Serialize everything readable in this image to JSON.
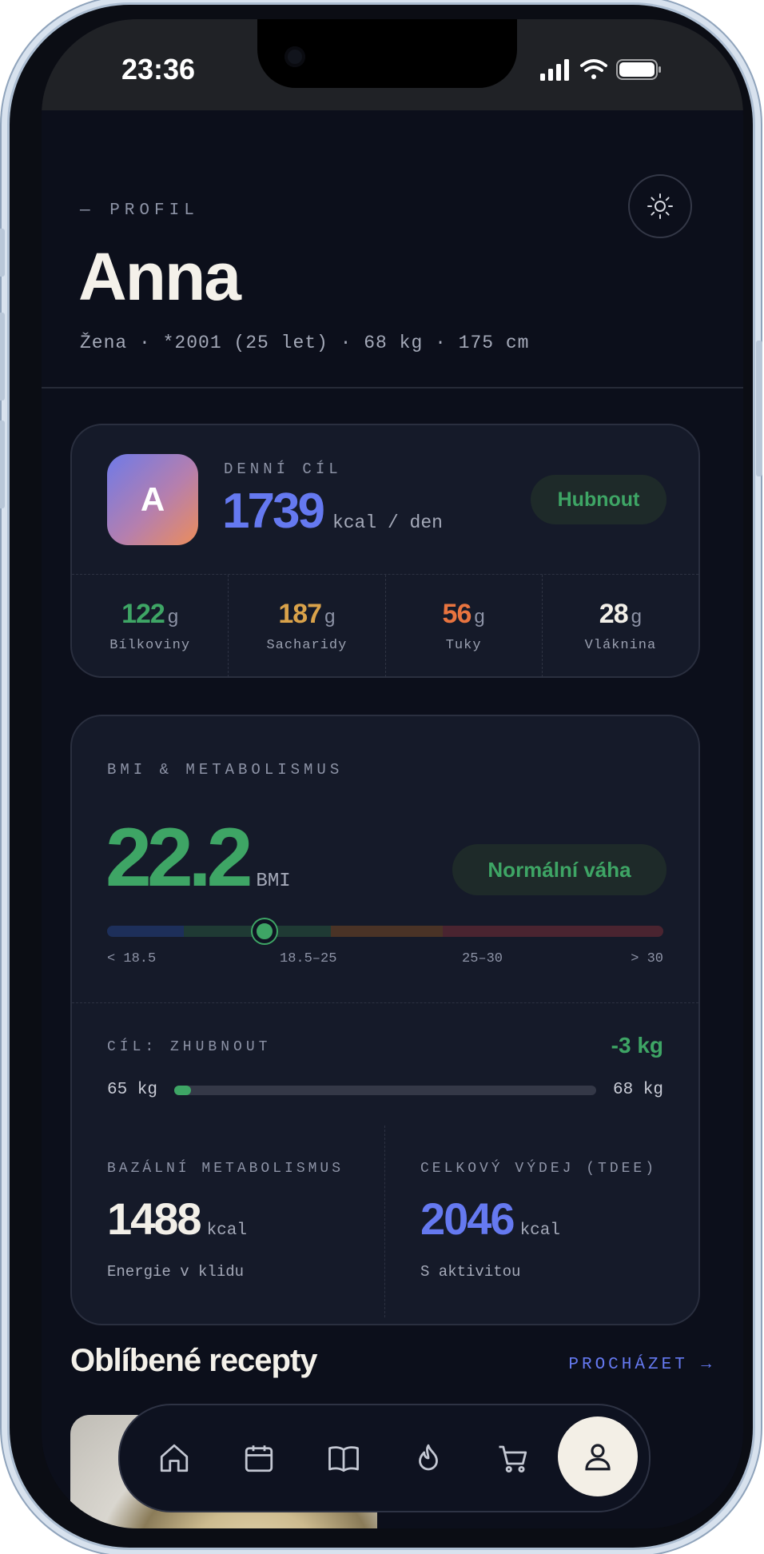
{
  "status_bar": {
    "time": "23:36"
  },
  "header": {
    "eyebrow": "— PROFIL",
    "name": "Anna",
    "meta": "Žena · *2001 (25 let) · 68 kg · 175 cm",
    "theme_icon": "sun-icon"
  },
  "goal_card": {
    "avatar_letter": "A",
    "label": "DENNÍ CÍL",
    "kcal": "1739",
    "kcal_unit": "kcal / den",
    "goal_badge": "Hubnout",
    "macros": [
      {
        "value": "122",
        "unit": "g",
        "name": "Bílkoviny",
        "color": "#3ea565"
      },
      {
        "value": "187",
        "unit": "g",
        "name": "Sacharidy",
        "color": "#d9a24a"
      },
      {
        "value": "56",
        "unit": "g",
        "name": "Tuky",
        "color": "#e8743f"
      },
      {
        "value": "28",
        "unit": "g",
        "name": "Vláknina",
        "color": "#f2efe8"
      }
    ]
  },
  "bmi_card": {
    "label": "BMI & METABOLISMUS",
    "bmi_value": "22.2",
    "bmi_unit": "BMI",
    "status_badge": "Normální váha",
    "scale_labels": [
      "< 18.5",
      "18.5–25",
      "25–30",
      "> 30"
    ],
    "goal_label": "CÍL: ZHUBNOUT",
    "goal_delta": "-3 kg",
    "goal_from": "65 kg",
    "goal_to": "68 kg",
    "goal_progress": 0.04,
    "bmr_label": "BAZÁLNÍ METABOLISMUS",
    "bmr_value": "1488",
    "bmr_unit": "kcal",
    "bmr_sub": "Energie v klidu",
    "tdee_label": "CELKOVÝ VÝDEJ (TDEE)",
    "tdee_value": "2046",
    "tdee_unit": "kcal",
    "tdee_sub": "S aktivitou"
  },
  "recipes": {
    "title": "Oblíbené recepty",
    "browse_link": "PROCHÁZET →"
  },
  "nav": {
    "items": [
      "home-icon",
      "calendar-icon",
      "book-icon",
      "flame-icon",
      "cart-icon",
      "profile-icon"
    ],
    "active": "profile-icon"
  },
  "colors": {
    "accent_blue": "#6579f0",
    "accent_green": "#3ea565",
    "background": "#0c0f1b"
  }
}
